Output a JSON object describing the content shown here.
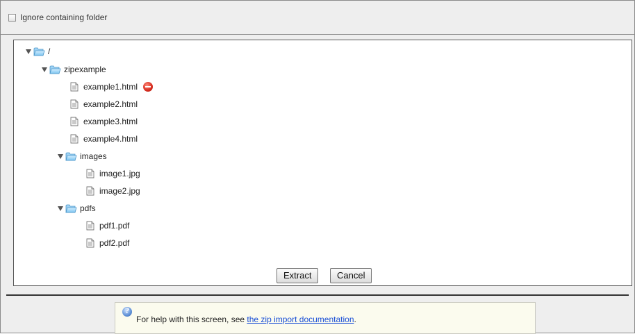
{
  "options": {
    "ignore_folder_label": "Ignore containing folder",
    "ignore_folder_checked": false
  },
  "tree": {
    "root": "/",
    "zipexample": "zipexample",
    "files": [
      "example1.html",
      "example2.html",
      "example3.html",
      "example4.html"
    ],
    "images_folder": "images",
    "images": [
      "image1.jpg",
      "image2.jpg"
    ],
    "pdfs_folder": "pdfs",
    "pdfs": [
      "pdf1.pdf",
      "pdf2.pdf"
    ]
  },
  "actions": {
    "extract_label": "Extract",
    "cancel_label": "Cancel"
  },
  "help": {
    "text": "For help with this screen, see ",
    "link_text": "the zip import documentation",
    "suffix": "."
  },
  "icons": {
    "folder": "folder-icon",
    "file": "file-icon",
    "remove": "remove-icon",
    "info": "info-icon",
    "expand": "expand-triangle-icon"
  },
  "colors": {
    "link": "#1a4fd6",
    "remove": "#d62b1e",
    "panel_bg": "#eeeeee",
    "help_bg": "#fbfbee"
  }
}
